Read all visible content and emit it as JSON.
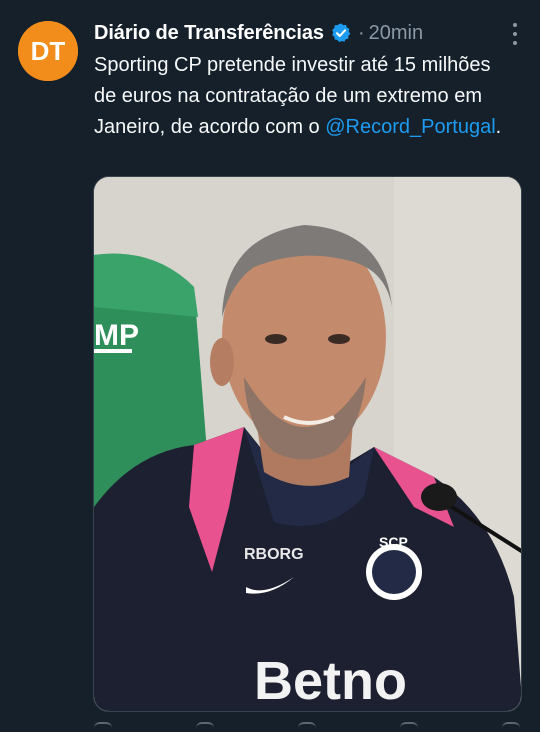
{
  "tweet": {
    "avatar_text": "DT",
    "author_name": "Diário de Transferências",
    "separator": "·",
    "time": "20min",
    "text_main": "Sporting CP pretende investir até 15 milhões de euros na contratação de um extremo em Janeiro, de acordo com o ",
    "mention": "@Record_Portugal",
    "text_end": "."
  },
  "media": {
    "chair_text": "MP",
    "jacket_brand_left": "RBORG",
    "badge_text": "SCP",
    "sponsor_text": "Betno"
  },
  "colors": {
    "background": "#15202b",
    "text": "#f7f9f9",
    "secondary": "#8b98a5",
    "link": "#1d9bf0",
    "avatar": "#f28c1a",
    "verified": "#1d9bf0"
  },
  "icons": [
    "verified-badge-icon",
    "more-options-icon"
  ]
}
